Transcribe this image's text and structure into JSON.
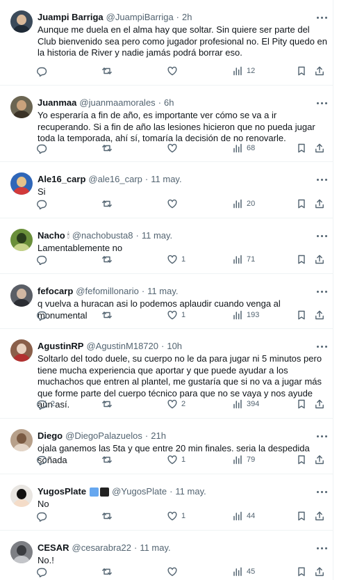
{
  "colors": {
    "text_primary": "#0f1419",
    "text_secondary": "#536471",
    "divider": "#eff3f4",
    "badge_blue": "#66a7ef",
    "badge_black": "#222222"
  },
  "icons": {
    "reply": "reply-icon",
    "retweet": "retweet-icon",
    "like": "heart-icon",
    "views": "views-bar-chart-icon",
    "bookmark": "bookmark-icon",
    "share": "share-icon",
    "more": "more-options-icon"
  },
  "tweets": [
    {
      "display_name": "Juampi Barriga",
      "handle": "@JuampiBarriga",
      "time": "2h",
      "text": "Aunque me duela en el alma hay que soltar. Sin quiere ser parte del Club bienvenido sea pero como jugador profesional no. El Pity quedo en la historia de River y nadie jamás podrá borrar eso.",
      "replies": "",
      "retweets": "",
      "likes": "",
      "views": "12"
    },
    {
      "display_name": "Juanmaa",
      "handle": "@juanmaamorales",
      "time": "6h",
      "text": "Yo esperaría a fin de año, es importante ver cómo se va a ir recuperando. Si a fin de año las lesiones hicieron que no pueda jugar toda la temporada, ahí sí, tomaría la decisión de no renovarle.",
      "replies": "",
      "retweets": "",
      "likes": "",
      "views": "68"
    },
    {
      "display_name": "Ale16_carp",
      "handle": "@ale16_carp",
      "time": "11 may.",
      "text": "Si",
      "replies": "",
      "retweets": "",
      "likes": "",
      "views": "20"
    },
    {
      "display_name": "Nacho",
      "name_emoji": "🕯",
      "handle": "@nachobusta8",
      "time": "11 may.",
      "text": "Lamentablemente no",
      "replies": "",
      "retweets": "",
      "likes": "1",
      "views": "71"
    },
    {
      "display_name": "fefocarp",
      "handle": "@fefomillonario",
      "time": "11 may.",
      "text": "q vuelva a huracan asi lo podemos aplaudir cuando venga al monumental",
      "replies": "",
      "retweets": "",
      "likes": "1",
      "views": "193"
    },
    {
      "display_name": "AgustinRP",
      "handle": "@AgustinM18720",
      "time": "10h",
      "text": "Soltarlo del todo duele, su cuerpo no le da para jugar ni 5 minutos pero tiene mucha experiencia que aportar y que puede ayudar a los muchachos que entren al plantel, me gustaría que si no va a jugar más que forme parte del cuerpo técnico para que no se vaya y nos ayude aún así.",
      "replies": "2",
      "retweets": "",
      "likes": "2",
      "views": "394"
    },
    {
      "display_name": "Diego",
      "handle": "@DiegoPalazuelos",
      "time": "21h",
      "text": "ojala ganemos las 5ta y que entre 20 min finales. seria la despedida soñada",
      "replies": "",
      "retweets": "",
      "likes": "1",
      "views": "79"
    },
    {
      "display_name": "YugosPlate",
      "has_badges": true,
      "handle": "@YugosPlate",
      "time": "11 may.",
      "text": "No",
      "replies": "",
      "retweets": "",
      "likes": "1",
      "views": "44"
    },
    {
      "display_name": "CESAR",
      "handle": "@cesarabra22",
      "time": "11 may.",
      "text": "No.!",
      "replies": "",
      "retweets": "",
      "likes": "",
      "views": "45"
    }
  ]
}
